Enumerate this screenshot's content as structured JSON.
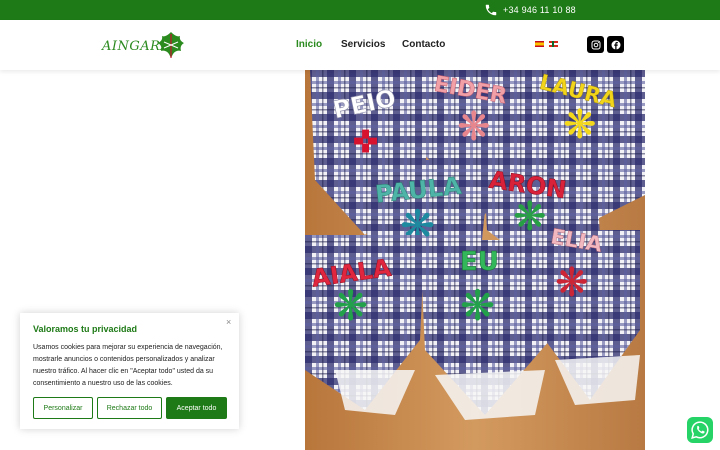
{
  "topbar": {
    "phone_icon": "phone-icon",
    "phone": "+34 946 11 10 88",
    "color": "#1e7a16"
  },
  "header": {
    "logo_text": "AINGARA",
    "nav": [
      {
        "label": "Inicio",
        "active": true
      },
      {
        "label": "Servicios",
        "active": false
      },
      {
        "label": "Contacto",
        "active": false
      }
    ],
    "languages": [
      "es-flag-icon",
      "eu-flag-icon"
    ],
    "social": [
      "instagram-icon",
      "facebook-icon"
    ]
  },
  "hero": {
    "names": [
      "PEIO",
      "EIDER",
      "LAURA",
      "PAULA",
      "ARON",
      "AIALA",
      "EU",
      "ELIA"
    ]
  },
  "cookie": {
    "title": "Valoramos tu privacidad",
    "close": "×",
    "text": "Usamos cookies para mejorar su experiencia de navegación, mostrarle anuncios o contenidos personalizados y analizar nuestro tráfico. Al hacer clic en \"Aceptar todo\" usted da su consentimiento a nuestro uso de las cookies.",
    "buttons": {
      "customize": "Personalizar",
      "reject": "Rechazar todo",
      "accept": "Aceptar todo"
    }
  },
  "whatsapp_icon": "whatsapp-icon"
}
